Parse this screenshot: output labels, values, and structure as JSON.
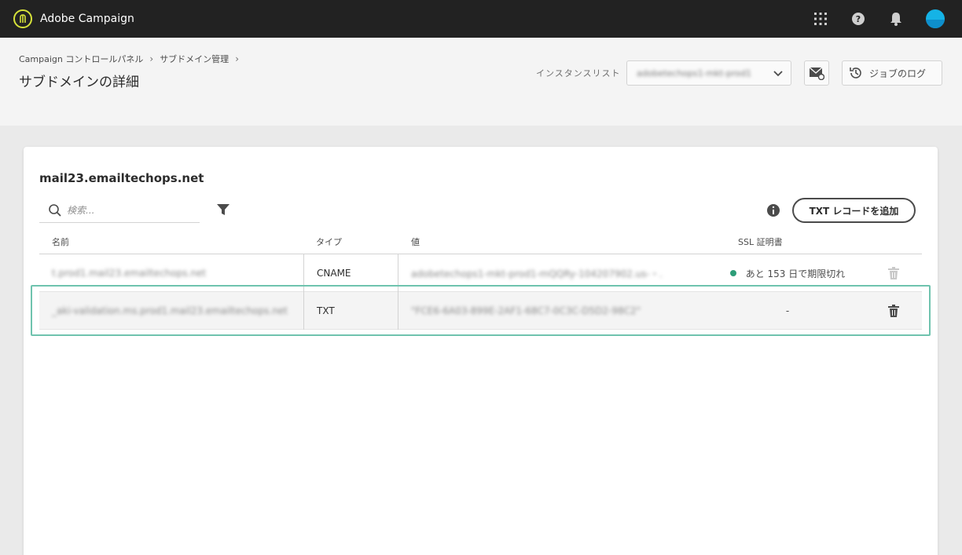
{
  "app": {
    "name": "Adobe Campaign"
  },
  "colors": {
    "topbar": "#222222",
    "accent_logo": "#d7e33a",
    "avatar": "#15b3e6",
    "status_ok": "#2d9d78",
    "selection": "#6fc3ae"
  },
  "icons": {
    "logo": "adobe-campaign-logo-icon",
    "apps": "apps-grid-icon",
    "help": "help-icon",
    "notifications": "bell-icon",
    "search": "search-icon",
    "filter": "filter-icon",
    "info": "info-icon",
    "delete": "trash-icon",
    "mail": "mail-settings-icon",
    "history": "history-icon",
    "chevron": "chevron-down-icon"
  },
  "header": {
    "breadcrumb": [
      "Campaign コントロールパネル",
      "サブドメイン管理"
    ],
    "title": "サブドメインの詳細",
    "instance_label": "インスタンスリスト",
    "instance_value": "adobetechops1-mkt-prod1",
    "job_log_label": "ジョブのログ"
  },
  "card": {
    "domain": "mail23.emailtechops.net",
    "search_placeholder": "検索...",
    "add_txt_label": "TXT レコードを追加",
    "columns": {
      "name": "名前",
      "type": "タイプ",
      "value": "値",
      "ssl": "SSL 証明書"
    },
    "rows": [
      {
        "name": "t.prod1.mail23.emailtechops.net",
        "type": "CNAME",
        "value": "adobetechops1-mkt-prod1-mQQRy-104207902.us-・.",
        "ssl": "あと 153 日で期限切れ"
      },
      {
        "name": "_aki-validation.ms.prod1.mail23.emailtechops.net",
        "type": "TXT",
        "value": "\"FCE6-6A03-899E-2AF1-68C7-0C3C-D5D2-98C2\"",
        "ssl": "-"
      }
    ]
  }
}
